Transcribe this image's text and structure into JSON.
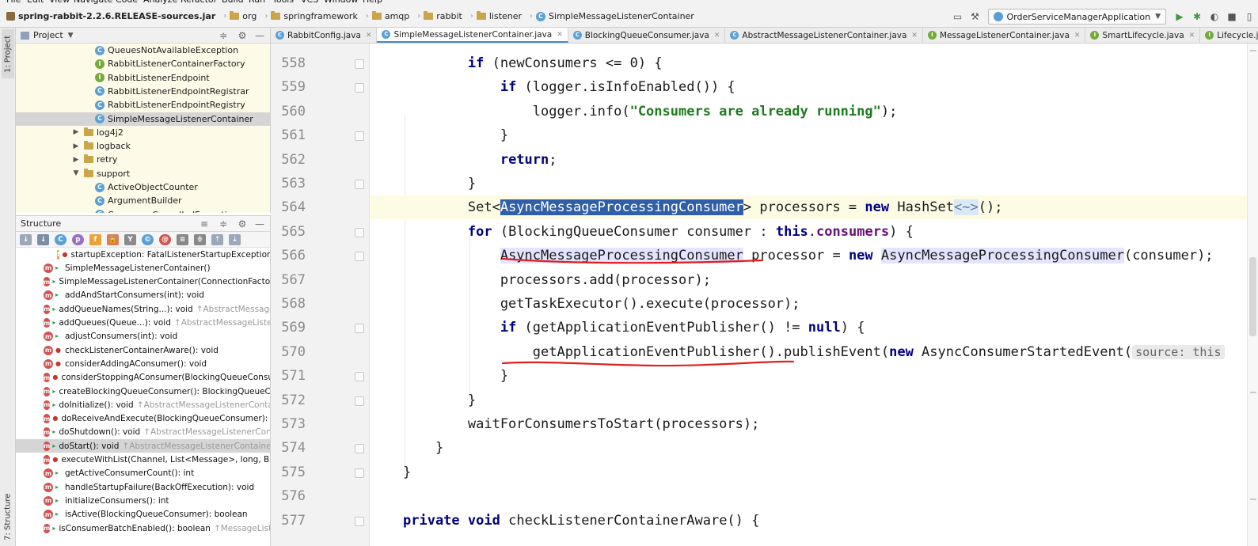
{
  "menu": [
    "File",
    "Edit",
    "View",
    "Navigate",
    "Code",
    "Analyze",
    "Refactor",
    "Build",
    "Run",
    "Tools",
    "VCS",
    "Window",
    "Help"
  ],
  "breadcrumb": [
    {
      "label": "spring-rabbit-2.2.6.RELEASE-sources.jar",
      "icon": "jar-icon"
    },
    {
      "label": "org",
      "icon": "folder-icon"
    },
    {
      "label": "springframework",
      "icon": "folder-icon"
    },
    {
      "label": "amqp",
      "icon": "folder-icon"
    },
    {
      "label": "rabbit",
      "icon": "folder-icon"
    },
    {
      "label": "listener",
      "icon": "folder-icon"
    },
    {
      "label": "SimpleMessageListenerContainer",
      "icon": "class-icon"
    }
  ],
  "run_config": {
    "label": "OrderServiceManagerApplication"
  },
  "left_strip": {
    "project_tab": "1: Project",
    "structure_tab": "7: Structure"
  },
  "project_panel": {
    "title": "Project",
    "rows": [
      {
        "label": "QueuesNotAvailableException",
        "kind": "class",
        "indent": 100
      },
      {
        "label": "RabbitListenerContainerFactory",
        "kind": "interface",
        "indent": 100
      },
      {
        "label": "RabbitListenerEndpoint",
        "kind": "interface",
        "indent": 100
      },
      {
        "label": "RabbitListenerEndpointRegistrar",
        "kind": "class",
        "indent": 100
      },
      {
        "label": "RabbitListenerEndpointRegistry",
        "kind": "class",
        "indent": 100
      },
      {
        "label": "SimpleMessageListenerContainer",
        "kind": "class",
        "indent": 100,
        "selected": true
      },
      {
        "label": "log4j2",
        "kind": "folder",
        "indent": 70,
        "arrow": "▶"
      },
      {
        "label": "logback",
        "kind": "folder",
        "indent": 70,
        "arrow": "▶"
      },
      {
        "label": "retry",
        "kind": "folder",
        "indent": 70,
        "arrow": "▶"
      },
      {
        "label": "support",
        "kind": "folder",
        "indent": 70,
        "arrow": "▼"
      },
      {
        "label": "ActiveObjectCounter",
        "kind": "class",
        "indent": 100
      },
      {
        "label": "ArgumentBuilder",
        "kind": "class",
        "indent": 100
      },
      {
        "label": "ConsumerCancelledException",
        "kind": "class",
        "indent": 100
      }
    ]
  },
  "structure_panel": {
    "title": "Structure",
    "rows": [
      {
        "label": "startupException: FatalListenerStartupException",
        "kind": "field",
        "indent": 52,
        "priv": true,
        "inherited": ""
      },
      {
        "label": "SimpleMessageListenerContainer()",
        "kind": "method",
        "indent": 35,
        "priv": false,
        "inherited": ""
      },
      {
        "label": "SimpleMessageListenerContainer(ConnectionFactory)",
        "kind": "method",
        "indent": 35,
        "priv": false,
        "inherited": ""
      },
      {
        "label": "addAndStartConsumers(int): void",
        "kind": "method",
        "indent": 35,
        "priv": false,
        "inherited": ""
      },
      {
        "label": "addQueueNames(String...): void",
        "kind": "method",
        "indent": 35,
        "priv": false,
        "inherited": "↑AbstractMessageListenerContainer"
      },
      {
        "label": "addQueues(Queue...): void",
        "kind": "method",
        "indent": 35,
        "priv": false,
        "inherited": "↑AbstractMessageListenerContainer"
      },
      {
        "label": "adjustConsumers(int): void",
        "kind": "method",
        "indent": 35,
        "priv": false,
        "inherited": ""
      },
      {
        "label": "checkListenerContainerAware(): void",
        "kind": "method",
        "indent": 35,
        "priv": true,
        "inherited": ""
      },
      {
        "label": "considerAddingAConsumer(): void",
        "kind": "method",
        "indent": 35,
        "priv": true,
        "inherited": ""
      },
      {
        "label": "considerStoppingAConsumer(BlockingQueueConsumer): void",
        "kind": "method",
        "indent": 35,
        "priv": true,
        "inherited": ""
      },
      {
        "label": "createBlockingQueueConsumer(): BlockingQueueConsumer",
        "kind": "method",
        "indent": 35,
        "priv": false,
        "inherited": ""
      },
      {
        "label": "doInitialize(): void",
        "kind": "method",
        "indent": 35,
        "priv": false,
        "inherited": "↑AbstractMessageListenerContainer"
      },
      {
        "label": "doReceiveAndExecute(BlockingQueueConsumer): boolean",
        "kind": "method",
        "indent": 35,
        "priv": true,
        "inherited": ""
      },
      {
        "label": "doShutdown(): void",
        "kind": "method",
        "indent": 35,
        "priv": false,
        "inherited": "↑AbstractMessageListenerContainer"
      },
      {
        "label": "doStart(): void",
        "kind": "method",
        "indent": 35,
        "priv": false,
        "inherited": "↑AbstractMessageListenerContainer",
        "selected": true
      },
      {
        "label": "executeWithList(Channel, List<Message>, long, BlockingQueueConsumer)",
        "kind": "method",
        "indent": 35,
        "priv": true,
        "inherited": ""
      },
      {
        "label": "getActiveConsumerCount(): int",
        "kind": "method",
        "indent": 35,
        "priv": false,
        "inherited": ""
      },
      {
        "label": "handleStartupFailure(BackOffExecution): void",
        "kind": "method",
        "indent": 35,
        "priv": false,
        "inherited": ""
      },
      {
        "label": "initializeConsumers(): int",
        "kind": "method",
        "indent": 35,
        "priv": false,
        "inherited": ""
      },
      {
        "label": "isActive(BlockingQueueConsumer): boolean",
        "kind": "method",
        "indent": 35,
        "priv": false,
        "inherited": ""
      },
      {
        "label": "isConsumerBatchEnabled(): boolean",
        "kind": "method",
        "indent": 35,
        "priv": false,
        "inherited": "↑MessageListenerContainer"
      }
    ]
  },
  "editor_tabs": [
    {
      "label": "RabbitConfig.java",
      "active": false,
      "green": false
    },
    {
      "label": "SimpleMessageListenerContainer.java",
      "active": true,
      "green": false
    },
    {
      "label": "BlockingQueueConsumer.java",
      "active": false,
      "green": false
    },
    {
      "label": "AbstractMessageListenerContainer.java",
      "active": false,
      "green": false
    },
    {
      "label": "MessageListenerContainer.java",
      "active": false,
      "green": true
    },
    {
      "label": "SmartLifecycle.java",
      "active": false,
      "green": true
    },
    {
      "label": "Lifecycle.java",
      "active": false,
      "green": true
    }
  ],
  "code": {
    "line_numbers": [
      "558",
      "559",
      "560",
      "561",
      "562",
      "563",
      "564",
      "565",
      "566",
      "567",
      "568",
      "569",
      "570",
      "571",
      "572",
      "573",
      "574",
      "575",
      "576",
      "577"
    ],
    "lines": [
      [
        {
          "t": "        "
        },
        {
          "t": "if",
          "c": "kw"
        },
        {
          "t": " (newConsumers <= 0) {"
        }
      ],
      [
        {
          "t": "            "
        },
        {
          "t": "if",
          "c": "kw"
        },
        {
          "t": " (logger.isInfoEnabled()) {"
        }
      ],
      [
        {
          "t": "                logger.info("
        },
        {
          "t": "\"Consumers are already running\"",
          "c": "str"
        },
        {
          "t": ");"
        }
      ],
      [
        {
          "t": "            }"
        }
      ],
      [
        {
          "t": "            "
        },
        {
          "t": "return",
          "c": "kw"
        },
        {
          "t": ";"
        }
      ],
      [
        {
          "t": "        }"
        }
      ],
      [
        {
          "t": "        Set<"
        },
        {
          "t": "AsyncMessageProcessingConsumer",
          "c": "selword"
        },
        {
          "t": "> processors = "
        },
        {
          "t": "new",
          "c": "kw"
        },
        {
          "t": " HashSet"
        },
        {
          "t": "<~>",
          "c": "diamond"
        },
        {
          "t": "();"
        }
      ],
      [
        {
          "t": "        "
        },
        {
          "t": "for",
          "c": "kw"
        },
        {
          "t": " (BlockingQueueConsumer consumer : "
        },
        {
          "t": "this",
          "c": "kw"
        },
        {
          "t": "."
        },
        {
          "t": "consumers",
          "c": "fld"
        },
        {
          "t": ") {"
        }
      ],
      [
        {
          "t": "            "
        },
        {
          "t": "AsyncMessageProcessingConsumer",
          "c": "hlref"
        },
        {
          "t": " processor = "
        },
        {
          "t": "new",
          "c": "kw"
        },
        {
          "t": " "
        },
        {
          "t": "AsyncMessageProcessingConsumer",
          "c": "hlref"
        },
        {
          "t": "(consumer);"
        }
      ],
      [
        {
          "t": "            processors.add(processor);"
        }
      ],
      [
        {
          "t": "            getTaskExecutor().execute(processor);"
        }
      ],
      [
        {
          "t": "            "
        },
        {
          "t": "if",
          "c": "kw"
        },
        {
          "t": " (getApplicationEventPublisher() != "
        },
        {
          "t": "null",
          "c": "kw"
        },
        {
          "t": ") {"
        }
      ],
      [
        {
          "t": "                getApplicationEventPublisher().publishEvent("
        },
        {
          "t": "new",
          "c": "kw"
        },
        {
          "t": " AsyncConsumerStartedEvent("
        },
        {
          "t": "source: this",
          "c": "hint"
        }
      ],
      [
        {
          "t": "            }"
        }
      ],
      [
        {
          "t": "        }"
        }
      ],
      [
        {
          "t": "        waitForConsumersToStart(processors);"
        }
      ],
      [
        {
          "t": "    }"
        }
      ],
      [
        {
          "t": "}"
        }
      ],
      [
        {
          "t": ""
        }
      ],
      [
        {
          "t": "private",
          "c": "kw"
        },
        {
          "t": " "
        },
        {
          "t": "void",
          "c": "kw"
        },
        {
          "t": " checkListenerContainerAware() {"
        }
      ]
    ]
  },
  "colors": {
    "keyword": "#000080",
    "string": "#1f7a1f",
    "selection": "#2f5fa8",
    "annotation_red": "#e02020"
  }
}
